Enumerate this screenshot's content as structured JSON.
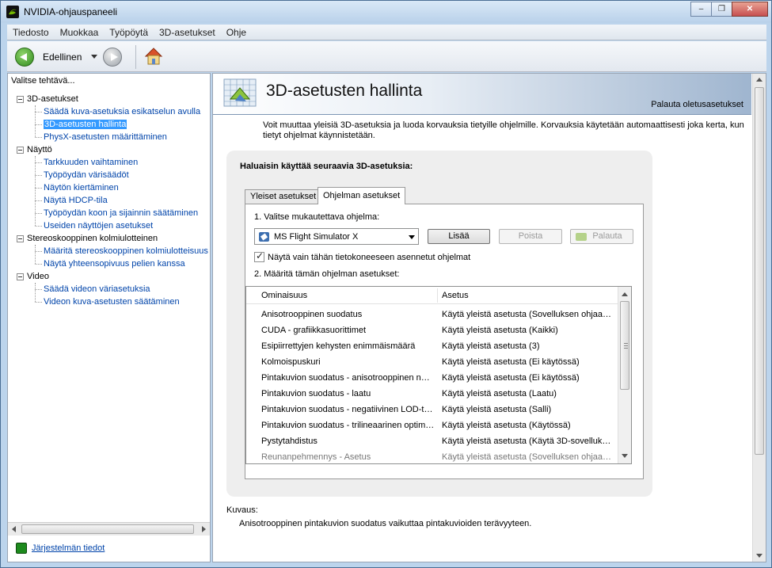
{
  "window": {
    "title": "NVIDIA-ohjauspaneeli",
    "minimize": "–",
    "maximize": "❐",
    "close": "✕"
  },
  "menu": [
    "Tiedosto",
    "Muokkaa",
    "Työpöytä",
    "3D-asetukset",
    "Ohje"
  ],
  "toolbar": {
    "back_label": "Edellinen"
  },
  "left": {
    "header": "Valitse tehtävä...",
    "tree": [
      {
        "label": "3D-asetukset",
        "children": [
          {
            "label": "Säädä kuva-asetuksia esikatselun avulla"
          },
          {
            "label": "3D-asetusten hallinta",
            "selected": true
          },
          {
            "label": "PhysX-asetusten määrittäminen"
          }
        ]
      },
      {
        "label": "Näyttö",
        "children": [
          {
            "label": "Tarkkuuden vaihtaminen"
          },
          {
            "label": "Työpöydän värisäädöt"
          },
          {
            "label": "Näytön kiertäminen"
          },
          {
            "label": "Näytä HDCP-tila"
          },
          {
            "label": "Työpöydän koon ja sijainnin säätäminen"
          },
          {
            "label": "Useiden näyttöjen asetukset"
          }
        ]
      },
      {
        "label": "Stereoskooppinen kolmiulotteinen",
        "children": [
          {
            "label": "Määritä stereoskooppinen kolmiulotteisuus"
          },
          {
            "label": "Näytä yhteensopivuus pelien kanssa"
          }
        ]
      },
      {
        "label": "Video",
        "children": [
          {
            "label": "Säädä videon väriasetuksia"
          },
          {
            "label": "Videon kuva-asetusten säätäminen"
          }
        ]
      }
    ],
    "system_info": "Järjestelmän tiedot"
  },
  "main": {
    "title": "3D-asetusten hallinta",
    "restore_defaults": "Palauta oletusasetukset",
    "description": "Voit muuttaa yleisiä 3D-asetuksia ja luoda korvauksia tietyille ohjelmille. Korvauksia käytetään automaattisesti joka kerta, kun tietyt ohjelmat käynnistetään.",
    "panel_heading": "Haluaisin käyttää seuraavia 3D-asetuksia:",
    "tabs": [
      "Yleiset asetukset",
      "Ohjelman asetukset"
    ],
    "step1_label": "1. Valitse mukautettava ohjelma:",
    "program_selected": "MS Flight Simulator X",
    "add_button": "Lisää",
    "remove_button": "Poista",
    "restore_button": "Palauta",
    "checkbox_label": "Näytä vain tähän tietokoneeseen asennetut ohjelmat",
    "checkbox_checked": true,
    "step2_label": "2. Määritä tämän ohjelman asetukset:",
    "grid": {
      "headers": [
        "Ominaisuus",
        "Asetus"
      ],
      "rows": [
        [
          "Anisotrooppinen suodatus",
          "Käytä yleistä asetusta (Sovelluksen ohjaa…"
        ],
        [
          "CUDA - grafiikkasuorittimet",
          "Käytä yleistä asetusta (Kaikki)"
        ],
        [
          "Esipiirrettyjen kehysten enimmäismäärä",
          "Käytä yleistä asetusta (3)"
        ],
        [
          "Kolmoispuskuri",
          "Käytä yleistä asetusta (Ei käytössä)"
        ],
        [
          "Pintakuvion suodatus - anisotrooppinen n…",
          "Käytä yleistä asetusta (Ei käytössä)"
        ],
        [
          "Pintakuvion suodatus - laatu",
          "Käytä yleistä asetusta (Laatu)"
        ],
        [
          "Pintakuvion suodatus - negatiivinen LOD-t…",
          "Käytä yleistä asetusta (Salli)"
        ],
        [
          "Pintakuvion suodatus - trilineaarinen optim…",
          "Käytä yleistä asetusta (Käytössä)"
        ],
        [
          "Pystytahdistus",
          "Käytä yleistä asetusta (Käytä 3D-sovelluk…"
        ],
        [
          "Reunanpehmennys - Asetus",
          "Käytä yleistä asetusta (Sovelluksen ohjaa…"
        ]
      ]
    },
    "desc_label": "Kuvaus:",
    "desc_text": "Anisotrooppinen pintakuvion suodatus vaikuttaa pintakuvioiden terävyyteen."
  }
}
